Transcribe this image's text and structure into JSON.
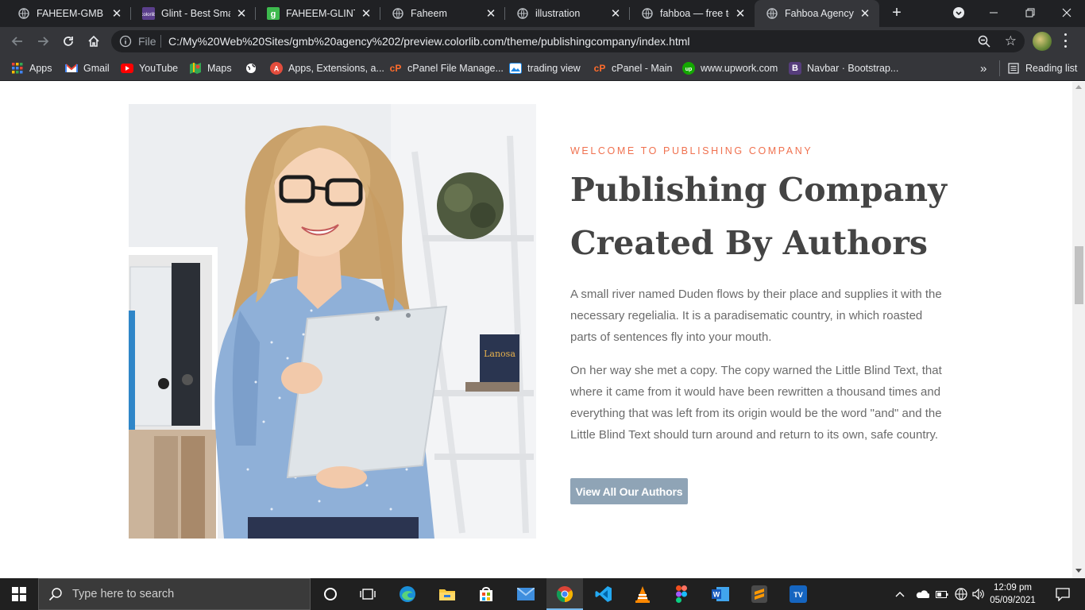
{
  "browser": {
    "tabs": [
      {
        "title": "FAHEEM-GMB AG"
      },
      {
        "title": "Glint - Best Small"
      },
      {
        "title": "FAHEEM-GLINT"
      },
      {
        "title": "Faheem"
      },
      {
        "title": "illustration"
      },
      {
        "title": "fahboa — free te"
      },
      {
        "title": "Fahboa Agency"
      }
    ],
    "address": {
      "scheme_label": "File",
      "url": "C:/My%20Web%20Sites/gmb%20agency%202/preview.colorlib.com/theme/publishingcompany/index.html"
    },
    "bookmarks": [
      {
        "label": "Apps"
      },
      {
        "label": "Gmail"
      },
      {
        "label": "YouTube"
      },
      {
        "label": "Maps"
      },
      {
        "label": ""
      },
      {
        "label": "Apps, Extensions, a..."
      },
      {
        "label": "cPanel File Manage..."
      },
      {
        "label": "trading view"
      },
      {
        "label": "cPanel - Main"
      },
      {
        "label": "www.upwork.com"
      },
      {
        "label": "Navbar · Bootstrap..."
      }
    ],
    "more_bookmarks": "»",
    "reading_list": "Reading list"
  },
  "content": {
    "eyebrow": "WELCOME TO PUBLISHING COMPANY",
    "heading": "Publishing Company Created By Authors",
    "paragraph1": "A small river named Duden flows by their place and supplies it with the necessary regelialia. It is a paradisematic country, in which roasted parts of sentences fly into your mouth.",
    "paragraph2": "On her way she met a copy. The copy warned the Little Blind Text, that where it came from it would have been rewritten a thousand times and everything that was left from its origin would be the word \"and\" and the Little Blind Text should turn around and return to its own, safe country.",
    "button": "View All Our Authors",
    "book_title": "Lanosa"
  },
  "colors": {
    "accent": "#f0714f",
    "button": "#8fa4b6",
    "heading": "#444444",
    "body_text": "#6b6b6b"
  },
  "taskbar": {
    "search_placeholder": "Type here to search",
    "time": "12:09 pm",
    "date": "05/09/2021"
  }
}
